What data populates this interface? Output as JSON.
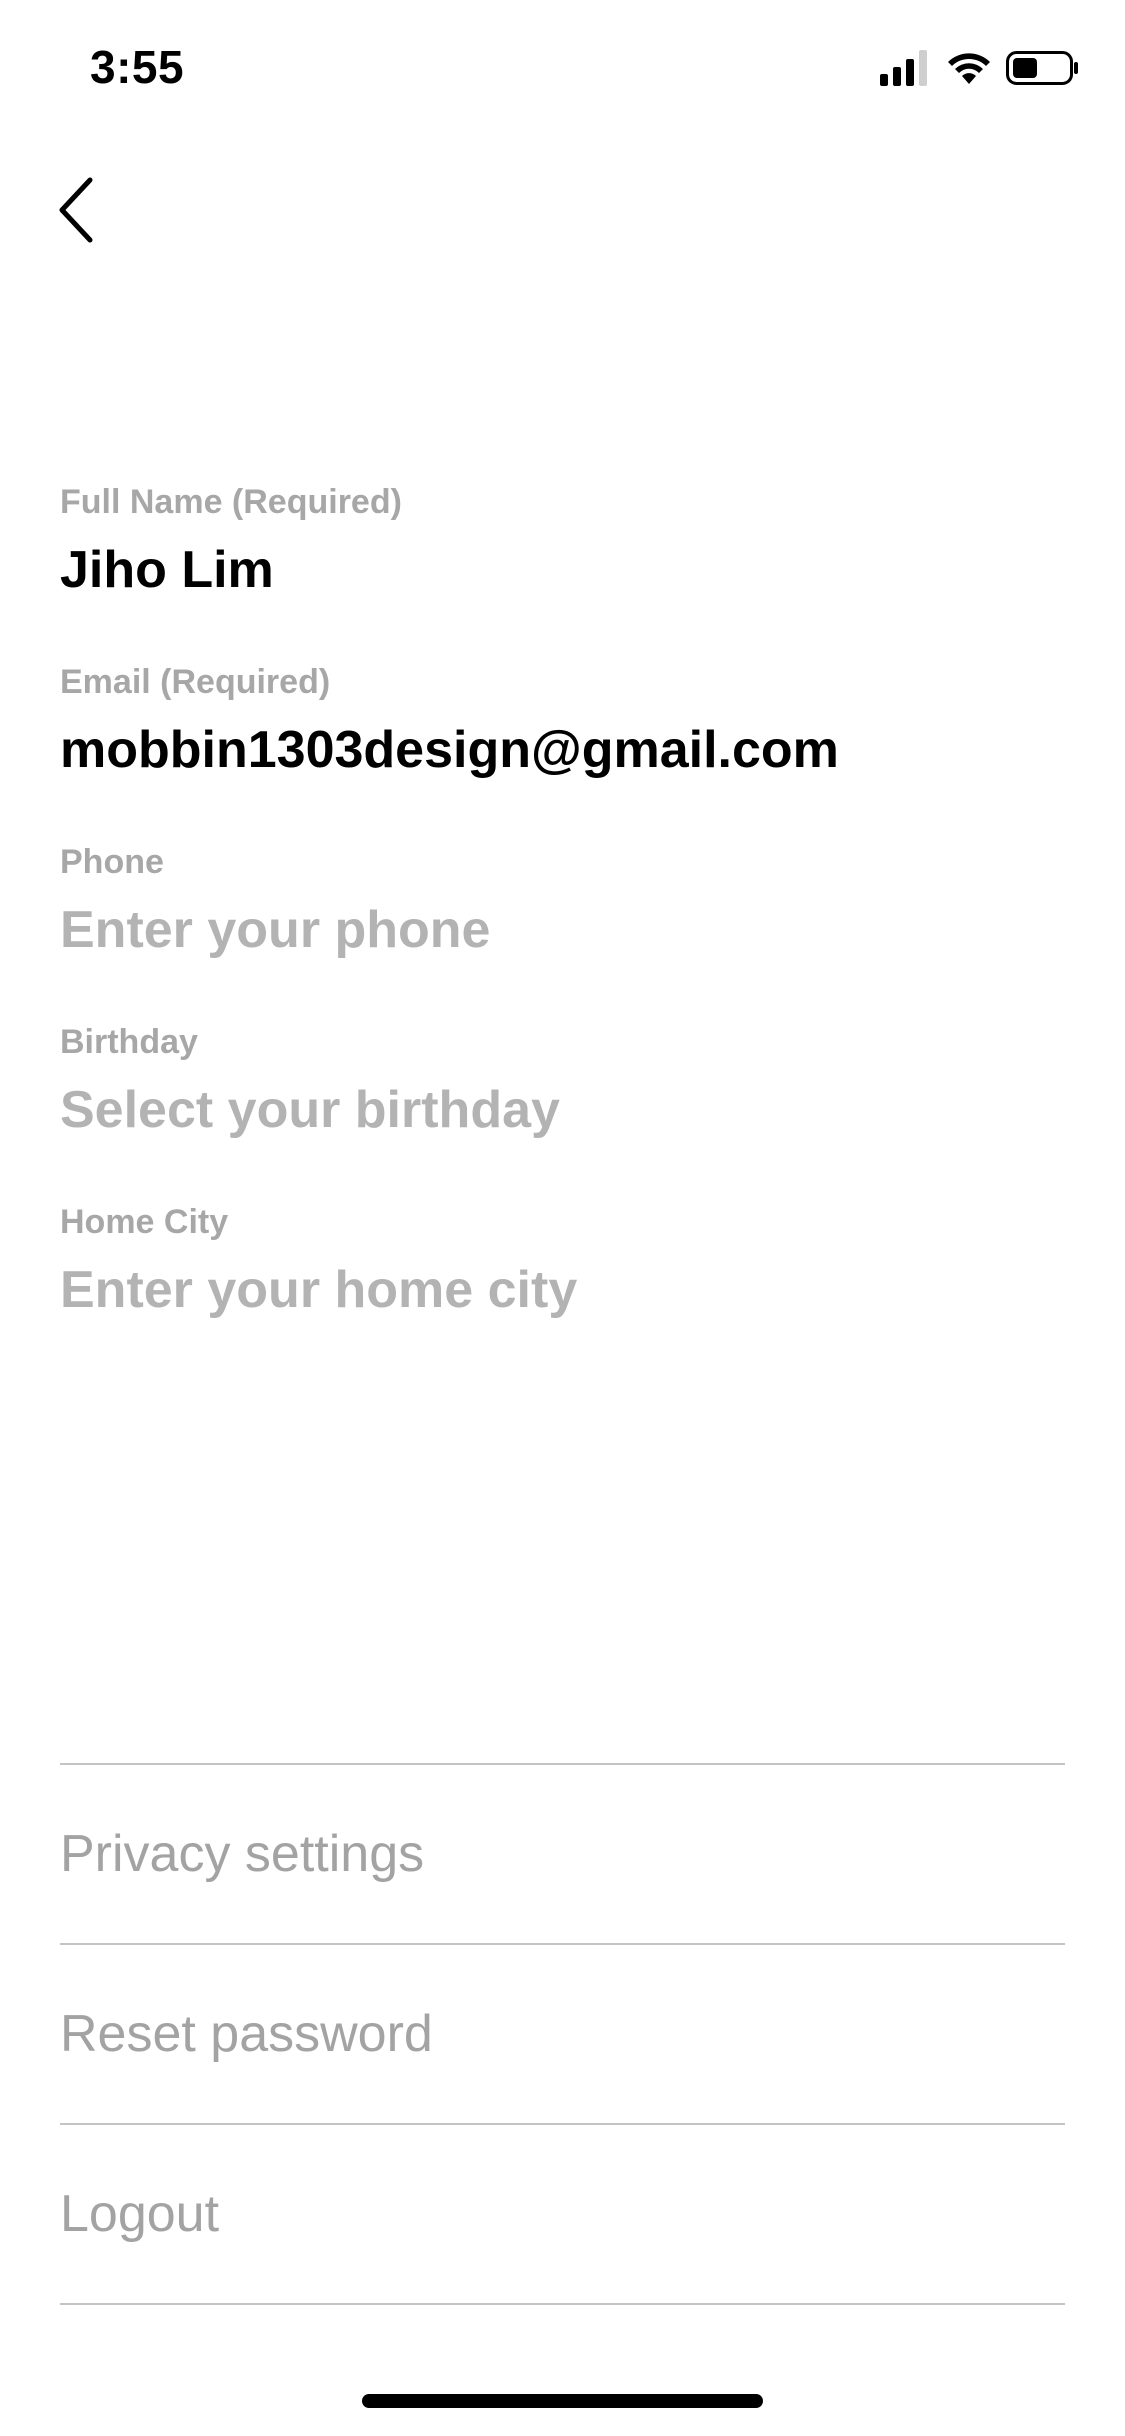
{
  "status_bar": {
    "time": "3:55",
    "icons": [
      "signal-icon",
      "wifi-icon",
      "battery-icon"
    ]
  },
  "header": {
    "back_icon": "chevron-left-icon"
  },
  "form": {
    "fields": [
      {
        "label": "Full Name (Required)",
        "value": "Jiho Lim",
        "placeholder": ""
      },
      {
        "label": "Email (Required)",
        "value": "mobbin1303design@gmail.com",
        "placeholder": ""
      },
      {
        "label": "Phone",
        "value": "",
        "placeholder": "Enter your phone"
      },
      {
        "label": "Birthday",
        "value": "",
        "placeholder": "Select your birthday"
      },
      {
        "label": "Home City",
        "value": "",
        "placeholder": "Enter your home city"
      }
    ]
  },
  "settings": {
    "items": [
      {
        "label": "Privacy settings"
      },
      {
        "label": "Reset password"
      },
      {
        "label": "Logout"
      }
    ]
  },
  "colors": {
    "label": "#a7a7a7",
    "placeholder": "#b3b3b3",
    "value": "#000000",
    "divider": "#c4c4c4",
    "settings_text": "#a3a3a3"
  }
}
